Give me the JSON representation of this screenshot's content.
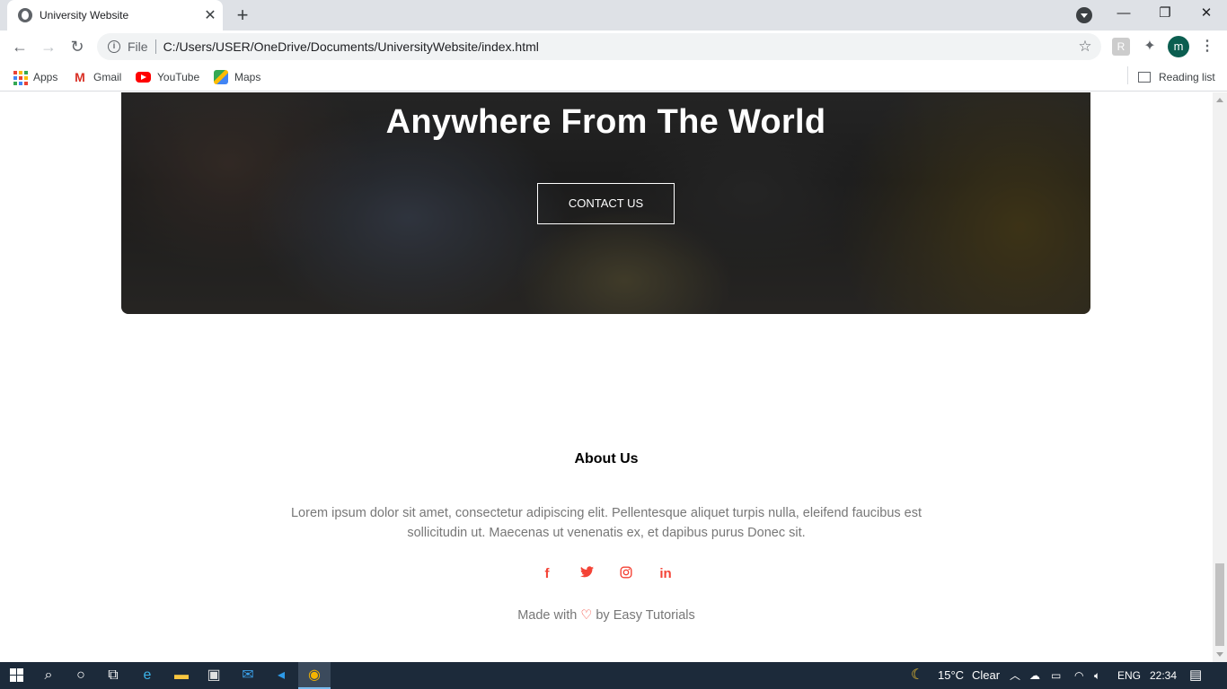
{
  "browser": {
    "tab_title": "University Website",
    "tab_close": "✕",
    "new_tab": "+",
    "window_controls": {
      "minimize": "—",
      "restore": "❐",
      "close": "✕"
    },
    "file_label": "File",
    "url": "C:/Users/USER/OneDrive/Documents/UniversityWebsite/index.html",
    "profile_initial": "m",
    "bookmarks": [
      {
        "label": "Apps",
        "icon": "apps-grid-icon"
      },
      {
        "label": "Gmail",
        "icon": "gmail-icon"
      },
      {
        "label": "YouTube",
        "icon": "youtube-icon"
      },
      {
        "label": "Maps",
        "icon": "maps-icon"
      }
    ],
    "reading_list": "Reading list"
  },
  "hero": {
    "title": "Anywhere From The World",
    "button": "CONTACT US"
  },
  "footer": {
    "title": "About Us",
    "text": "Lorem ipsum dolor sit amet, consectetur adipiscing elit. Pellentesque aliquet turpis nulla, eleifend faucibus est sollicitudin ut. Maecenas ut venenatis ex, et dapibus purus Donec sit.",
    "socials": [
      "facebook-icon",
      "twitter-icon",
      "instagram-icon",
      "linkedin-icon"
    ],
    "made_with_prefix": "Made with",
    "made_with_suffix": "by Easy Tutorials",
    "accent_color": "#f44336"
  },
  "taskbar": {
    "weather_temp": "15°C",
    "weather_text": "Clear",
    "language": "ENG",
    "time": "22:34"
  }
}
